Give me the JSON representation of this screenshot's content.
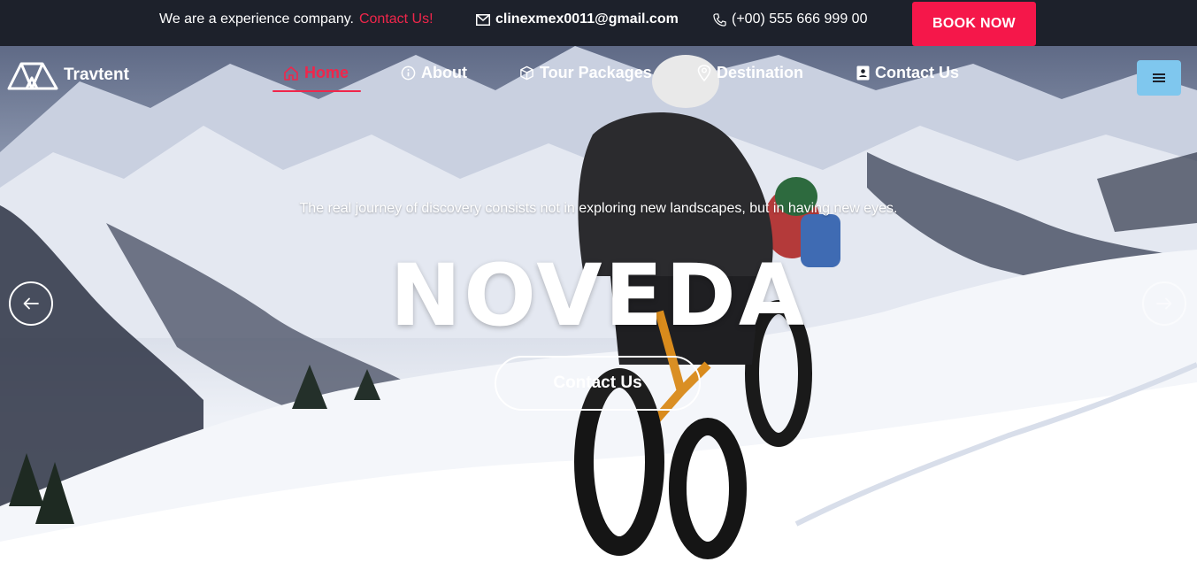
{
  "topbar": {
    "tagline": "We are a experience company.",
    "contact_link": "Contact Us!",
    "email": "clinexmex0011@gmail.com",
    "phone": "(+00) 555 666 999 00",
    "book_button": "BOOK NOW",
    "email_icon": "envelope-icon",
    "phone_icon": "phone-icon"
  },
  "brand": {
    "name": "Travtent",
    "logo_icon": "tent-icon"
  },
  "nav": {
    "items": [
      {
        "label": "Home",
        "icon": "home-icon",
        "active": true
      },
      {
        "label": "About",
        "icon": "info-icon"
      },
      {
        "label": "Tour Packages",
        "icon": "box-icon"
      },
      {
        "label": "Destination",
        "icon": "map-pin-icon"
      },
      {
        "label": "Contact Us",
        "icon": "contact-book-icon"
      }
    ],
    "menu_icon": "hamburger-icon"
  },
  "hero": {
    "tagline": "The real journey of discovery consists not in exploring new landscapes, but in having new eyes.",
    "title": "NOVEDA",
    "cta": "Contact Us",
    "prev_icon": "arrow-left-icon",
    "next_icon": "arrow-right-icon"
  },
  "colors": {
    "accent": "#f0264b",
    "book_button": "#f5174a",
    "topbar_bg": "#1d212b",
    "menu_button": "#7fc7ee"
  }
}
